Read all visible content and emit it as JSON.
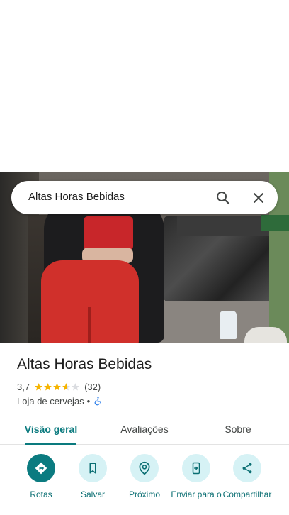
{
  "search": {
    "query": "Altas Horas Bebidas"
  },
  "place": {
    "title": "Altas Horas Bebidas",
    "rating": "3,7",
    "rating_value": 3.7,
    "review_count": "(32)",
    "category": "Loja de cervejas",
    "separator": "•",
    "accessibility_icon": "wheelchair-icon"
  },
  "tabs": [
    {
      "label": "Visão geral",
      "selected": true
    },
    {
      "label": "Avaliações",
      "selected": false
    },
    {
      "label": "Sobre",
      "selected": false
    }
  ],
  "actions": [
    {
      "label": "Rotas",
      "icon": "directions-icon"
    },
    {
      "label": "Salvar",
      "icon": "bookmark-icon"
    },
    {
      "label": "Próximo",
      "icon": "nearby-icon"
    },
    {
      "label": "Enviar para o",
      "icon": "send-to-phone-icon"
    },
    {
      "label": "Compartilhar",
      "icon": "share-icon"
    }
  ],
  "colors": {
    "accent": "#0b7b80",
    "action_bg": "#d6f2f5",
    "star": "#f6b400",
    "wheelchair": "#1a73e8"
  }
}
